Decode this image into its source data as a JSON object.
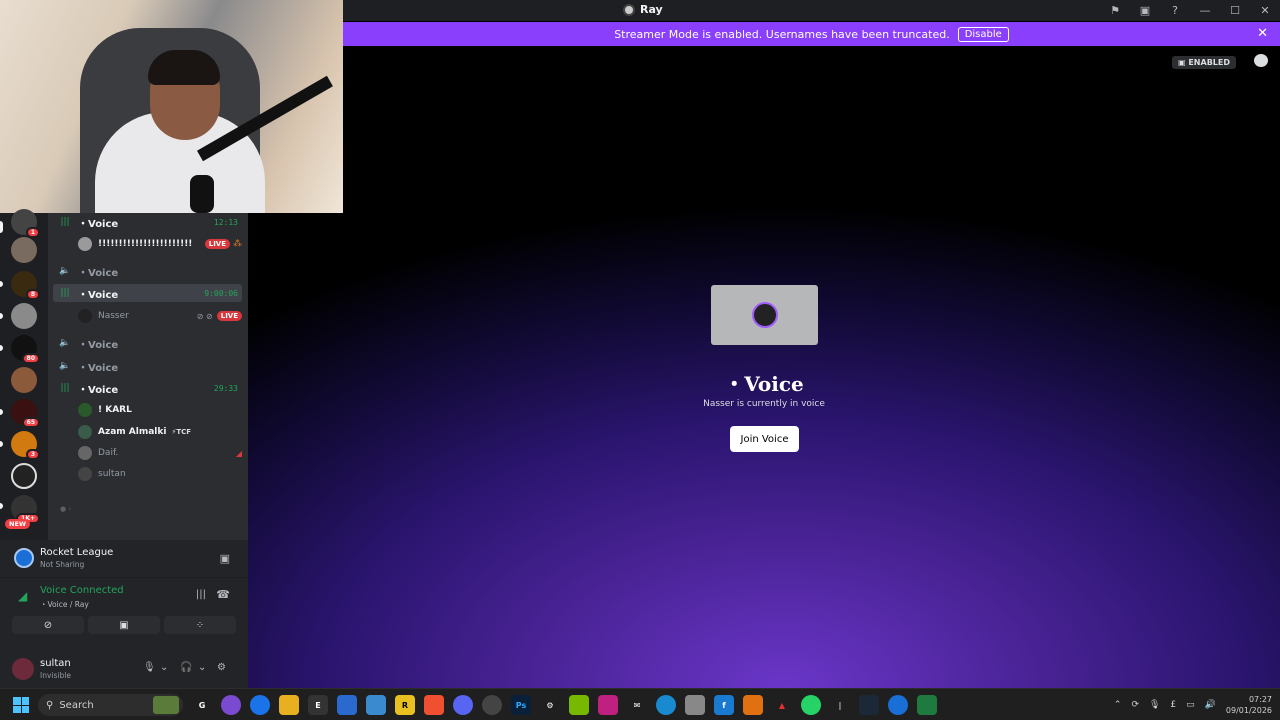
{
  "window": {
    "title": "Ray"
  },
  "banner": {
    "message": "Streamer Mode is enabled. Usernames have been truncated.",
    "disable_label": "Disable"
  },
  "stage": {
    "enabled_badge": "ENABLED",
    "channel_title": "・Voice",
    "subtitle": "Nasser is currently in voice",
    "join_label": "Join Voice"
  },
  "servers": [
    {
      "badge": "1"
    },
    {
      "badge": ""
    },
    {
      "badge": "8"
    },
    {
      "badge": ""
    },
    {
      "badge": "80"
    },
    {
      "badge": ""
    },
    {
      "badge": "65"
    },
    {
      "badge": "3"
    },
    {
      "badge": ""
    },
    {
      "badge": "1K+"
    }
  ],
  "rail_new_badge": "NEW",
  "channels": [
    {
      "name": "・Voice",
      "time": "12:13",
      "active": true
    },
    {
      "name": "・Voice",
      "time": "",
      "active": false
    },
    {
      "name": "・Voice",
      "time": "9:00:06",
      "active": true
    },
    {
      "name": "・Voice",
      "time": "",
      "active": false
    },
    {
      "name": "・Voice",
      "time": "",
      "active": false
    },
    {
      "name": "・Voice",
      "time": "29:33",
      "active": true
    }
  ],
  "voice_users": {
    "u1": {
      "name": "!!!!!!!!!!!!!!!!!!!!!!!",
      "live": "LIVE"
    },
    "u2": {
      "name": "Nasser",
      "live": "LIVE"
    },
    "u3": {
      "name": "! KARL"
    },
    "u4": {
      "name": "Azam Almalki",
      "tag": "⚡TCF"
    },
    "u5": {
      "name": "Daif."
    },
    "u6": {
      "name": "sultan"
    }
  },
  "activity": {
    "game": "Rocket League",
    "status": "Not Sharing"
  },
  "voice_connection": {
    "status": "Voice Connected",
    "location": "・Voice / Ray"
  },
  "user": {
    "name": "sultan",
    "status": "Invisible"
  },
  "taskbar": {
    "search_placeholder": "Search",
    "time": "07:27",
    "date": "09/01/2026",
    "lang": "£"
  },
  "colors": {
    "accent": "#8a3ffc",
    "green": "#23a55a",
    "live_red": "#da373c"
  }
}
